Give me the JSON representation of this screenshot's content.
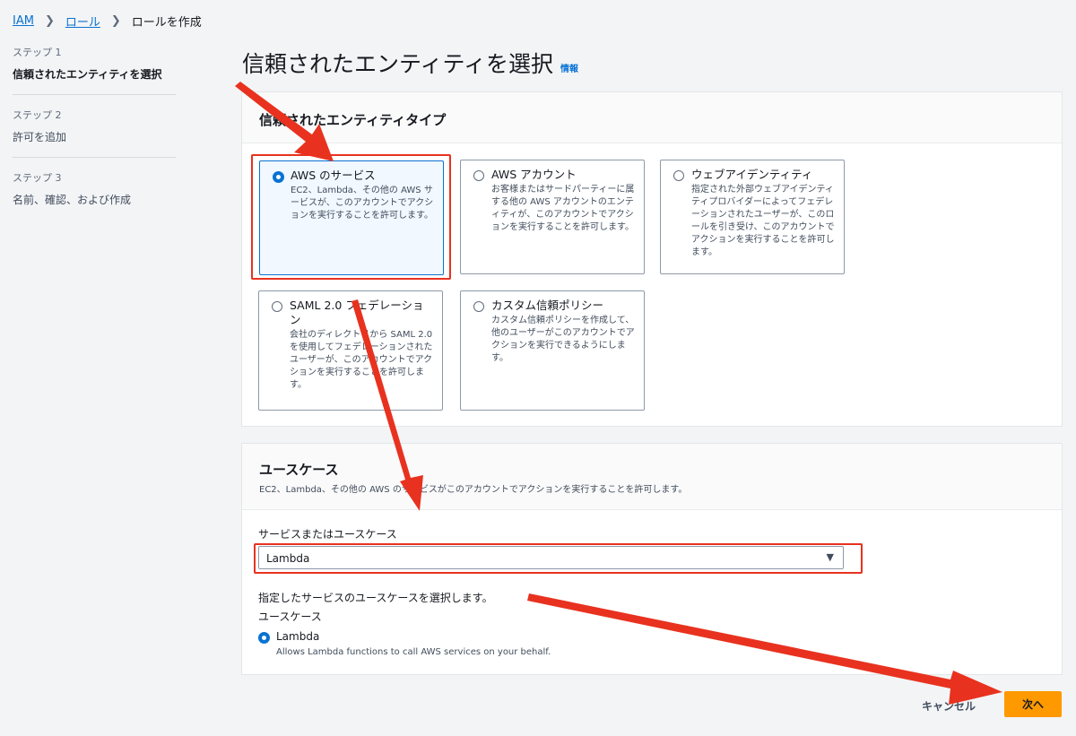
{
  "breadcrumb": {
    "items": [
      {
        "label": "IAM"
      },
      {
        "label": "ロール"
      },
      {
        "label": "ロールを作成"
      }
    ]
  },
  "steps": [
    {
      "num": "ステップ 1",
      "label": "信頼されたエンティティを選択",
      "active": true
    },
    {
      "num": "ステップ 2",
      "label": "許可を追加"
    },
    {
      "num": "ステップ 3",
      "label": "名前、確認、および作成"
    }
  ],
  "page": {
    "title": "信頼されたエンティティを選択",
    "info": "情報"
  },
  "entity_panel": {
    "title": "信頼されたエンティティタイプ",
    "options": [
      {
        "title": "AWS のサービス",
        "desc": "EC2、Lambda、その他の AWS サービスが、このアカウントでアクションを実行することを許可します。",
        "selected": true
      },
      {
        "title": "AWS アカウント",
        "desc": "お客様またはサードパーティーに属する他の AWS アカウントのエンティティが、このアカウントでアクションを実行することを許可します。",
        "selected": false
      },
      {
        "title": "ウェブアイデンティティ",
        "desc": "指定された外部ウェブアイデンティティプロバイダーによってフェデレーションされたユーザーが、このロールを引き受け、このアカウントでアクションを実行することを許可します。",
        "selected": false
      },
      {
        "title": "SAML 2.0 フェデレーション",
        "desc": "会社のディレクトリから SAML 2.0 を使用してフェデレーションされたユーザーが、このアカウントでアクションを実行することを許可します。",
        "selected": false
      },
      {
        "title": "カスタム信頼ポリシー",
        "desc": "カスタム信頼ポリシーを作成して、他のユーザーがこのアカウントでアクションを実行できるようにします。",
        "selected": false
      }
    ]
  },
  "usecase_panel": {
    "title": "ユースケース",
    "desc": "EC2、Lambda、その他の AWS のサービスがこのアカウントでアクションを実行することを許可します。",
    "service_label": "サービスまたはユースケース",
    "service_value": "Lambda",
    "select_hint": "指定したサービスのユースケースを選択します。",
    "usecase_label": "ユースケース",
    "option": {
      "label": "Lambda",
      "desc": "Allows Lambda functions to call AWS services on your behalf."
    }
  },
  "footer": {
    "cancel": "キャンセル",
    "next": "次へ"
  },
  "colors": {
    "accent": "#0972d3",
    "primary_button": "#ff9900",
    "annotation": "#e8321f"
  }
}
